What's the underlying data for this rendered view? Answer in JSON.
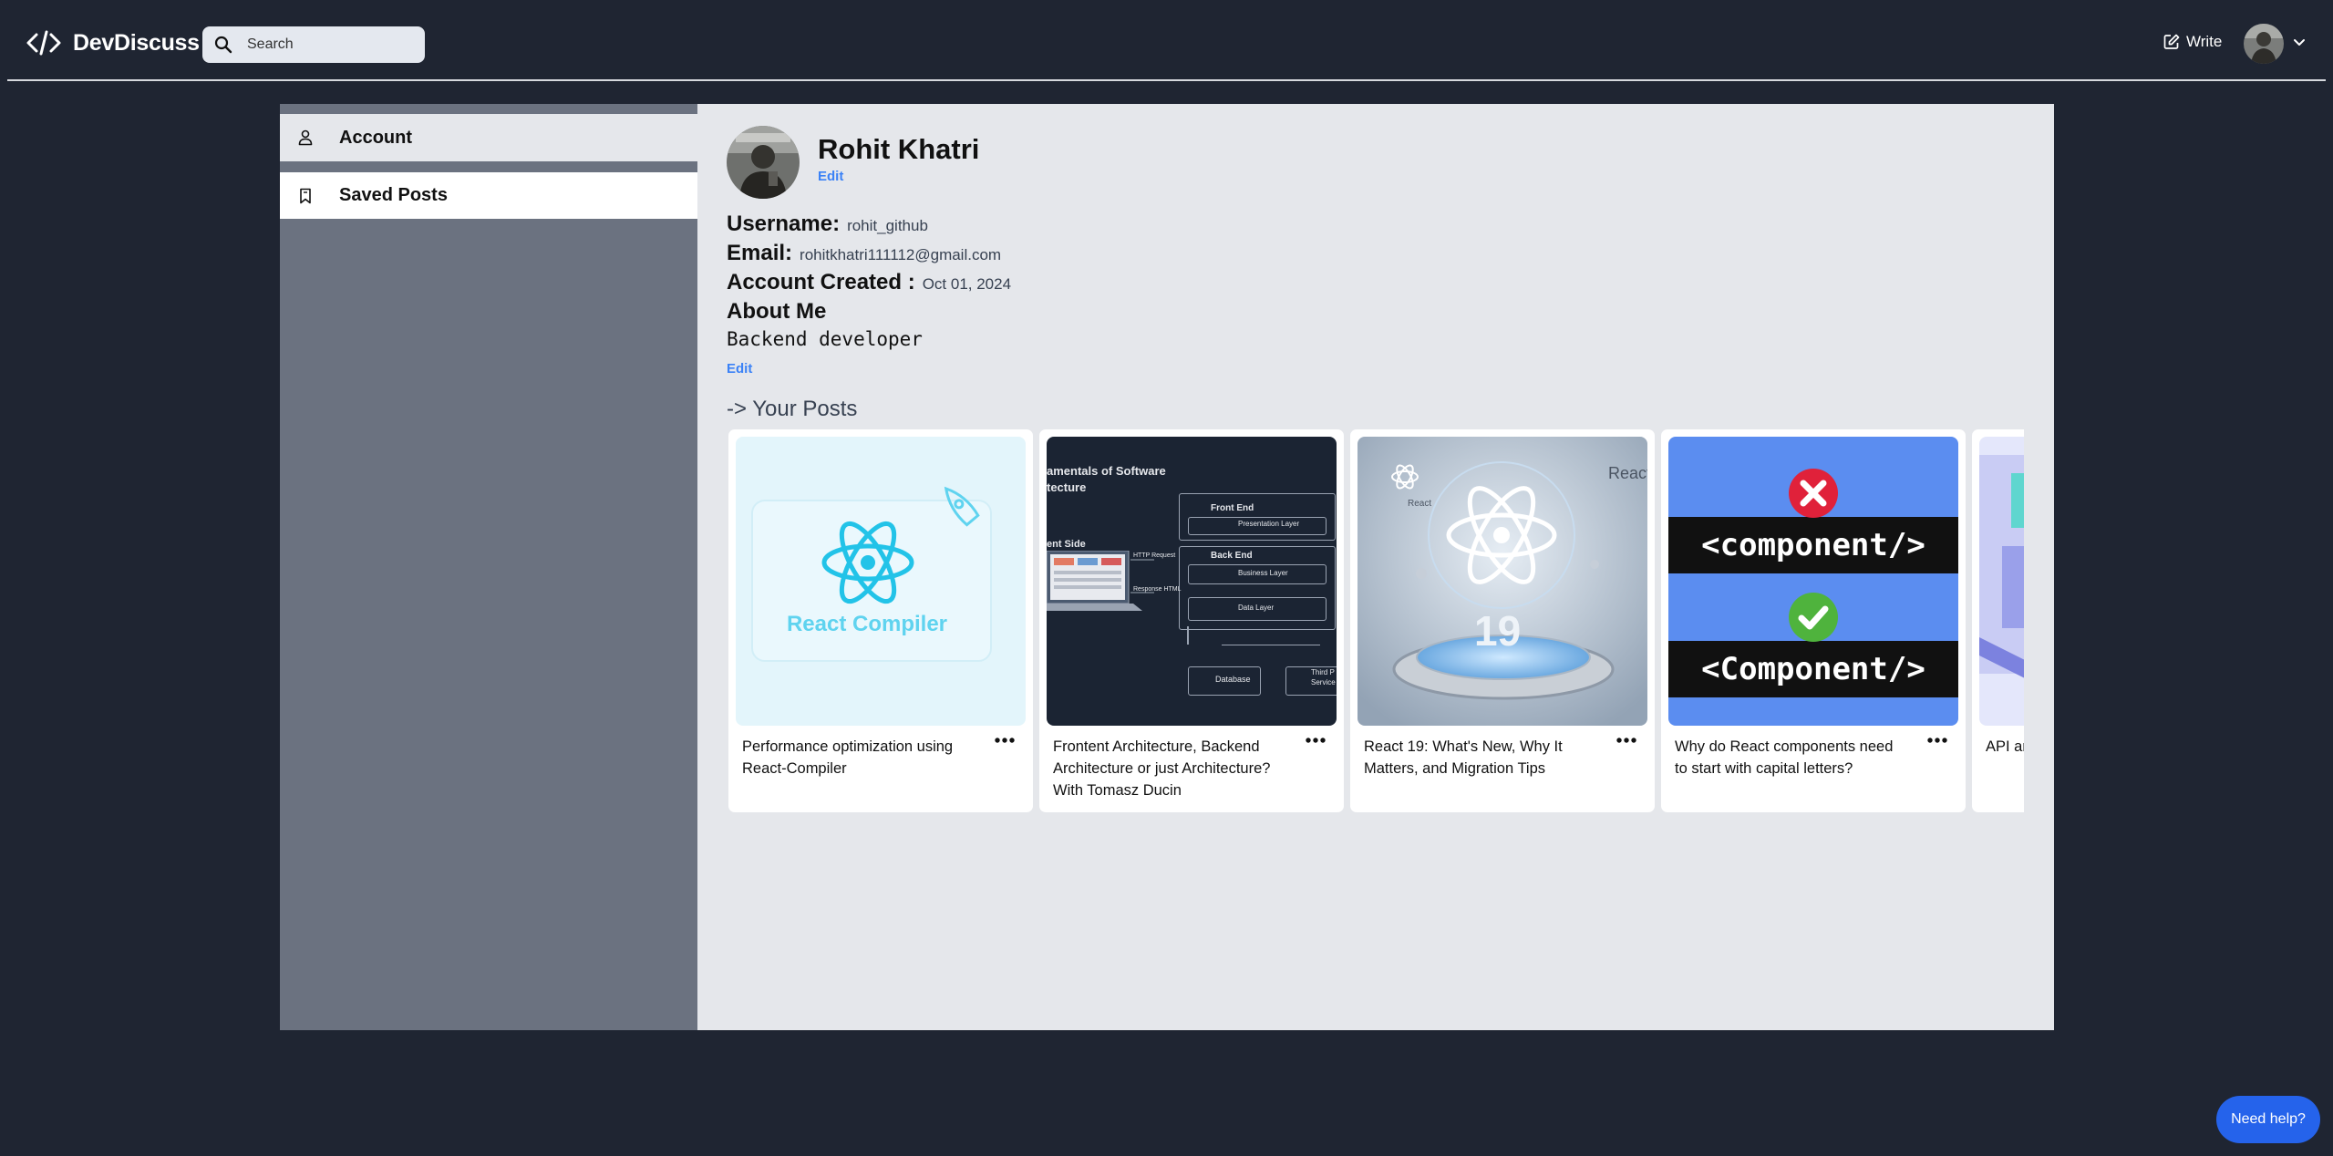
{
  "navbar": {
    "logo_text": "DevDiscuss",
    "search_placeholder": "Search",
    "write_label": "Write"
  },
  "sidebar": {
    "items": [
      {
        "label": "Account"
      },
      {
        "label": "Saved Posts"
      }
    ]
  },
  "profile": {
    "name": "Rohit Khatri",
    "edit_name_label": "Edit",
    "username_label": "Username:",
    "username": "rohit_github",
    "email_label": "Email:",
    "email": "rohitkhatri111112@gmail.com",
    "created_label": "Account Created :",
    "created": "Oct 01, 2024",
    "about_label": "About Me",
    "about": "Backend developer",
    "edit_about_label": "Edit"
  },
  "posts": {
    "heading": "-> Your Posts",
    "items": [
      {
        "title": "Performance optimization using React-Compiler",
        "thumb_text": "React Compiler"
      },
      {
        "title": "Frontent Architecture, Backend Architecture or just Architecture? With Tomasz Ducin",
        "thumb_lines": [
          "amentals of Software",
          "tecture",
          "Front End",
          "Presentation Layer",
          "Back End",
          "Business Layer",
          "Data Layer",
          "ent Side",
          "HTTP Request",
          "Response HTML",
          "Database",
          "Third P",
          "Service"
        ]
      },
      {
        "title": "React 19: What's New, Why It Matters, and Migration Tips",
        "thumb_text": "19",
        "thumb_labels": [
          "React",
          "React"
        ]
      },
      {
        "title": "Why do React components need to start with capital letters?",
        "thumb_lines": [
          "<component/>",
          "<Component/>"
        ]
      },
      {
        "title": "API ar Optim"
      }
    ]
  },
  "help_label": "Need help?",
  "colors": {
    "background": "#1f2532",
    "sidebar": "#6b7280",
    "main": "#e5e7eb",
    "accent": "#3b82f6",
    "help_button": "#2563eb"
  },
  "icons": [
    "code-icon",
    "search-icon",
    "edit-icon",
    "chevron-down-icon",
    "user-icon",
    "bookmark-icon",
    "more-icon"
  ]
}
